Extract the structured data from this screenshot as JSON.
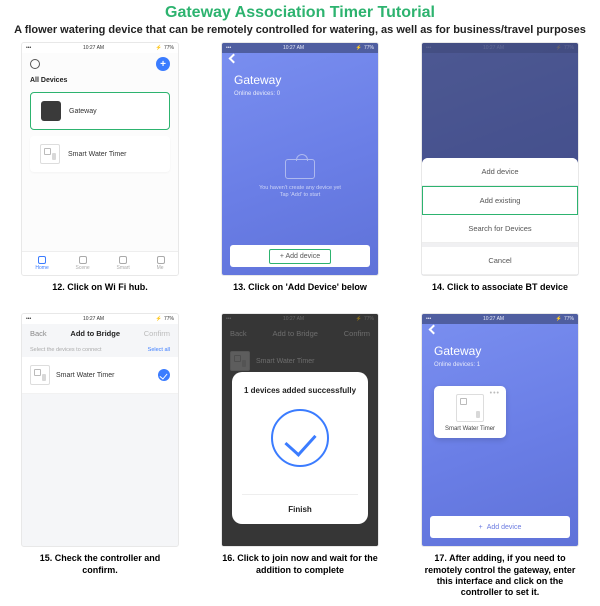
{
  "title": "Gateway Association Timer Tutorial",
  "subtitle": "A flower watering device that can be remotely controlled for watering, as well as for business/travel purposes",
  "status": {
    "time": "10:27 AM",
    "battery": "77%"
  },
  "captions": {
    "c12": "12. Click on Wi Fi hub.",
    "c13": "13. Click on 'Add Device' below",
    "c14": "14. Click to associate BT device",
    "c15": "15. Check the controller and confirm.",
    "c16": "16. Click to join now and wait for the addition to complete",
    "c17": "17. After adding, if you need to remotely control the gateway, enter this interface and click on the controller to set it."
  },
  "s12": {
    "all_devices": "All Devices",
    "gateway": "Gateway",
    "smart_timer": "Smart Water Timer",
    "tabs": {
      "home": "Home",
      "scene": "Scene",
      "smart": "Smart",
      "me": "Me"
    }
  },
  "s13": {
    "title": "Gateway",
    "sub": "Online devices: 0",
    "empty1": "You haven't create any device yet",
    "empty2": "Tap 'Add' to start",
    "add": "Add device"
  },
  "s14": {
    "add_device": "Add device",
    "add_existing": "Add existing",
    "search": "Search for Devices",
    "cancel": "Cancel"
  },
  "s15": {
    "back": "Back",
    "title": "Add to Bridge",
    "confirm": "Confirm",
    "hint": "Select the devices to connect",
    "select_all": "Select all",
    "item": "Smart Water Timer"
  },
  "s16": {
    "title_bg": "Add to Bridge",
    "item_bg": "Smart Water Timer",
    "modal_title": "1 devices added successfully",
    "finish": "Finish"
  },
  "s17": {
    "title": "Gateway",
    "sub": "Online devices: 1",
    "card_label": "Smart Water Timer",
    "add": "Add device"
  }
}
